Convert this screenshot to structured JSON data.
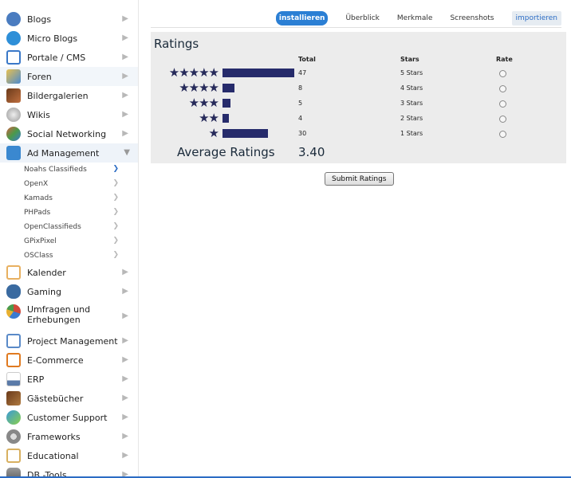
{
  "sidebar": {
    "items": [
      {
        "label": "Blogs",
        "icon": "blogs-icon",
        "color": "#4a7cc0"
      },
      {
        "label": "Micro Blogs",
        "icon": "micro-blogs-icon",
        "color": "#2e8fd8"
      },
      {
        "label": "Portale / CMS",
        "icon": "portal-cms-icon",
        "color": "#3a78c8"
      },
      {
        "label": "Foren",
        "icon": "forum-icon",
        "color": "#d8a030"
      },
      {
        "label": "Bildergalerien",
        "icon": "gallery-icon",
        "color": "#8a4a2a"
      },
      {
        "label": "Wikis",
        "icon": "wiki-icon",
        "color": "#9a9a9a"
      },
      {
        "label": "Social Networking",
        "icon": "social-networking-icon",
        "color": "#c05a3a"
      },
      {
        "label": "Ad Management",
        "icon": "ad-management-icon",
        "color": "#3a88d0"
      }
    ],
    "subitems": [
      {
        "label": "Noahs Classifieds"
      },
      {
        "label": "OpenX"
      },
      {
        "label": "Kamads"
      },
      {
        "label": "PHPads"
      },
      {
        "label": "OpenClassifieds"
      },
      {
        "label": "GPixPixel"
      },
      {
        "label": "OSClass"
      }
    ],
    "items2": [
      {
        "label": "Kalender",
        "icon": "calendar-icon",
        "color": "#e8b060"
      },
      {
        "label": "Gaming",
        "icon": "gaming-icon",
        "color": "#3a6aa0"
      },
      {
        "label": "Umfragen und Erhebungen",
        "icon": "poll-icon",
        "color": "#d04a3a"
      },
      {
        "label": "Project Management",
        "icon": "project-management-icon",
        "color": "#5a8ac8"
      },
      {
        "label": "E-Commerce",
        "icon": "shopping-cart-icon",
        "color": "#e07a20"
      },
      {
        "label": "ERP",
        "icon": "erp-chart-icon",
        "color": "#5a7aa8"
      },
      {
        "label": "Gästebücher",
        "icon": "guestbook-icon",
        "color": "#8a5a2a"
      },
      {
        "label": "Customer Support",
        "icon": "customer-support-icon",
        "color": "#3a9ad8"
      },
      {
        "label": "Frameworks",
        "icon": "frameworks-icon",
        "color": "#8a8a8a"
      },
      {
        "label": "Educational",
        "icon": "educational-icon",
        "color": "#d8b060"
      },
      {
        "label": "DB -Tools",
        "icon": "db-tools-icon",
        "color": "#7a7a7a"
      }
    ]
  },
  "tabs": {
    "install": "installieren",
    "overview": "Überblick",
    "features": "Merkmale",
    "screenshots": "Screenshots",
    "import": "importieren"
  },
  "ratings": {
    "title": "Ratings",
    "headers": {
      "total": "Total",
      "stars": "Stars",
      "rate": "Rate"
    },
    "rows": [
      {
        "stars_glyph": "★★★★★",
        "total": "47",
        "label": "5 Stars",
        "count": 47
      },
      {
        "stars_glyph": "★★★★",
        "total": "8",
        "label": "4 Stars",
        "count": 8
      },
      {
        "stars_glyph": "★★★",
        "total": "5",
        "label": "3 Stars",
        "count": 5
      },
      {
        "stars_glyph": "★★",
        "total": "4",
        "label": "2 Stars",
        "count": 4
      },
      {
        "stars_glyph": "★",
        "total": "30",
        "label": "1 Stars",
        "count": 30
      }
    ],
    "average_label": "Average Ratings",
    "average_value": "3.40",
    "submit_label": "Submit Ratings"
  },
  "colors": {
    "accent": "#2b7fd4",
    "bar": "#262b6b"
  }
}
